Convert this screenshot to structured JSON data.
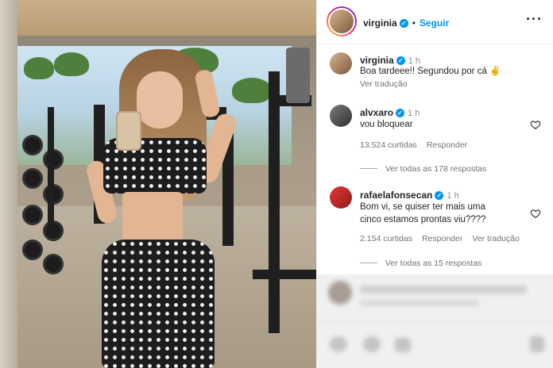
{
  "post": {
    "author": "virginia",
    "follow_label": "Seguir",
    "separator": "•",
    "more_label": "···"
  },
  "caption": {
    "author": "virginia",
    "time": "1 h",
    "text": "Boa tardeee!! Segundou por cá ✌",
    "translate_label": "Ver tradução"
  },
  "comments": [
    {
      "author": "alvxaro",
      "time": "1 h",
      "text": "vou bloquear",
      "likes": "13.524 curtidas",
      "reply_label": "Responder",
      "view_replies": "Ver todas as 178 respostas"
    },
    {
      "author": "rafaelafonsecan",
      "time": "1 h",
      "text_line1": "Bom vi, se quiser ter mais uma",
      "text_line2": "cinco estamos prontas viu????",
      "likes": "2.154 curtidas",
      "reply_label": "Responder",
      "translate_label": "Ver tradução",
      "view_replies": "Ver todas as 15 respostas"
    }
  ],
  "colors": {
    "accent_blue": "#0095f6",
    "text_primary": "#262626",
    "text_secondary": "#737373"
  },
  "icons": [
    "verified-badge-icon",
    "heart-icon",
    "more-icon"
  ]
}
